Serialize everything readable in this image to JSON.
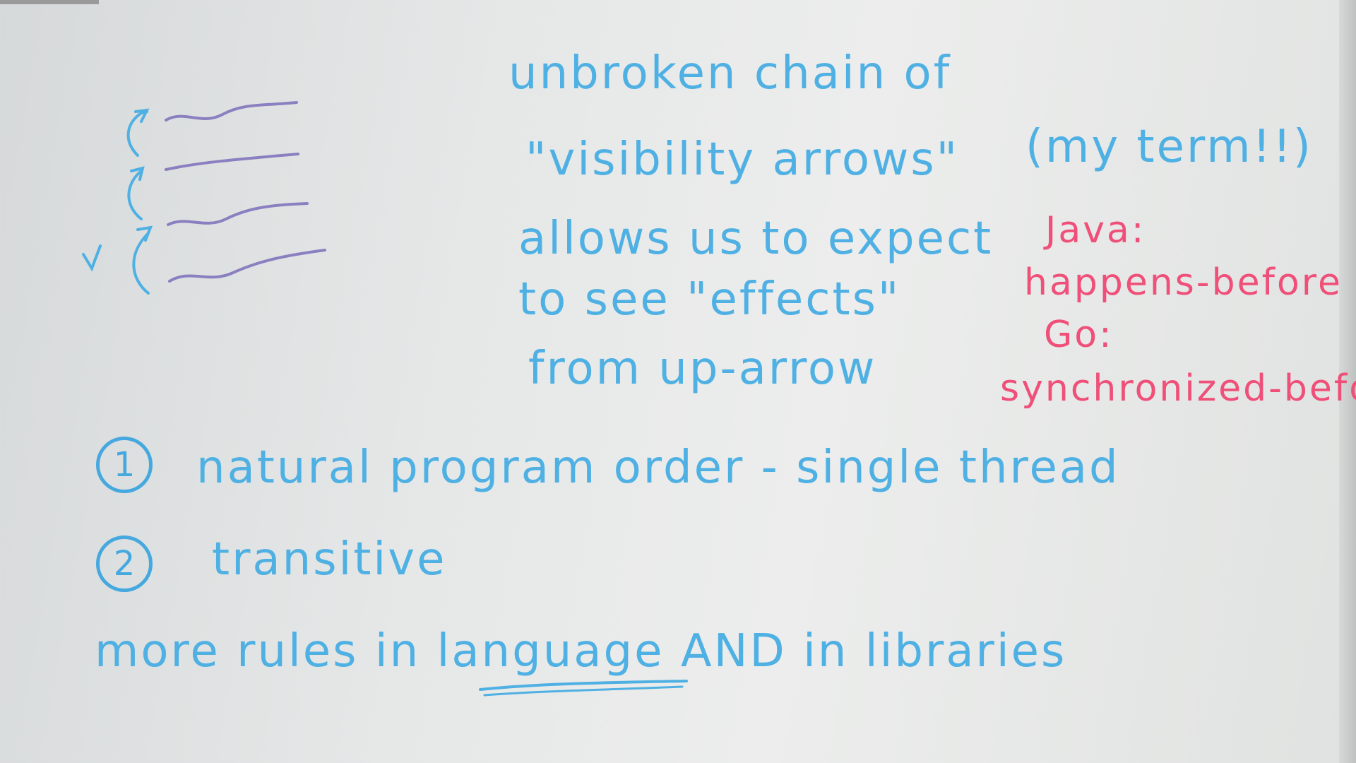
{
  "board": {
    "ink_blue": "#4fb0e3",
    "ink_red": "#ef4f78",
    "ink_purple": "#8a7fc0"
  },
  "text": {
    "line1": "unbroken chain of",
    "line2": "\"visibility arrows\"",
    "line2_aside": "(my term!!)",
    "line3": "allows us to expect",
    "line4": "to see \"effects\"",
    "line5": "from up-arrow",
    "java_label": "Java:",
    "java_term": "happens-before",
    "go_label": "Go:",
    "go_term": "synchronized-before",
    "rule1_num": "1",
    "rule1": "natural program order - single thread",
    "rule2_num": "2",
    "rule2": "transitive",
    "more_rules": "more rules in language AND in libraries"
  }
}
